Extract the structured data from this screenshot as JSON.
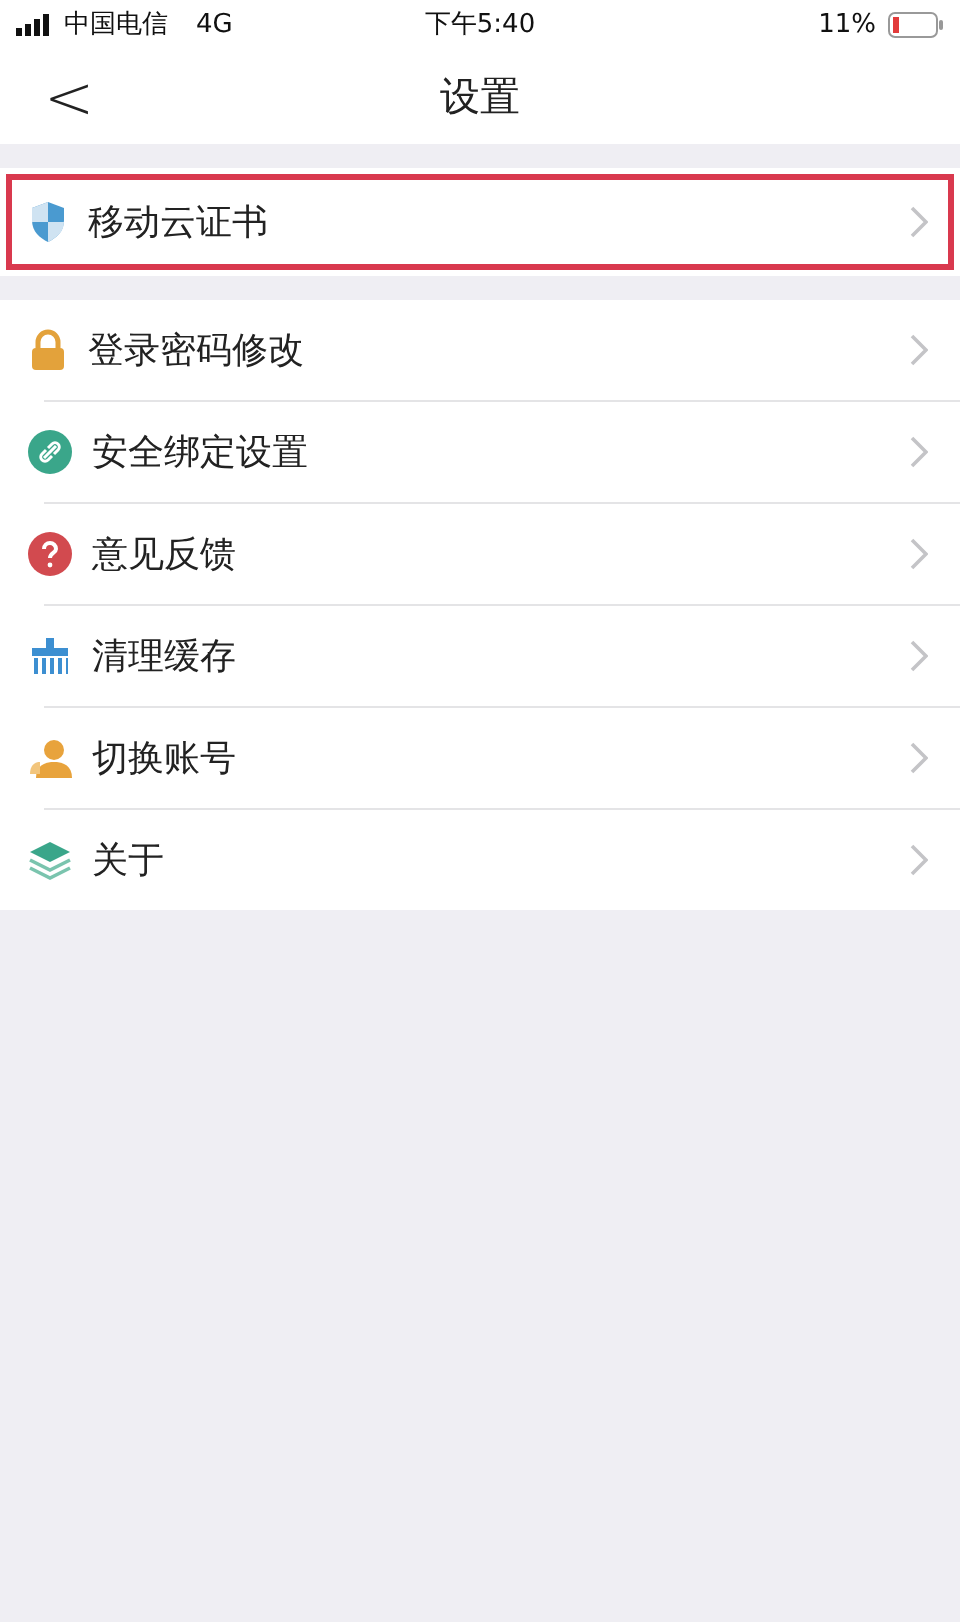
{
  "status_bar": {
    "carrier": "中国电信",
    "network": "4G",
    "time": "下午5:40",
    "battery": "11%"
  },
  "nav": {
    "back": "<",
    "title": "设置"
  },
  "sections": [
    {
      "items": [
        {
          "label": "移动云证书",
          "kind": "shield",
          "highlighted": true
        }
      ]
    },
    {
      "items": [
        {
          "label": "登录密码修改",
          "kind": "lock",
          "highlighted": false
        },
        {
          "label": "安全绑定设置",
          "kind": "link",
          "highlighted": false
        },
        {
          "label": "意见反馈",
          "kind": "question",
          "highlighted": false
        },
        {
          "label": "清理缓存",
          "kind": "broom",
          "highlighted": false
        },
        {
          "label": "切换账号",
          "kind": "person",
          "highlighted": false
        },
        {
          "label": "关于",
          "kind": "layers",
          "highlighted": false
        }
      ]
    }
  ]
}
